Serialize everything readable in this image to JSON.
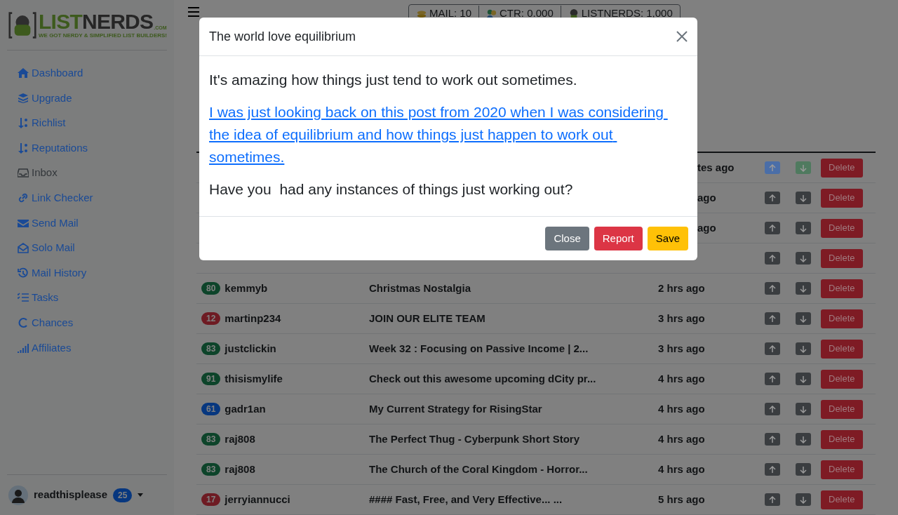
{
  "logo": {
    "word_1": "LIST",
    "word_2": "NERDS",
    "suffix": ".COM",
    "tagline": "WE GOT NERDY & SIMPLIFIED LIST BUILDERS!"
  },
  "sidebar": {
    "items": [
      {
        "label": "Dashboard",
        "selected": false
      },
      {
        "label": "Upgrade",
        "selected": false
      },
      {
        "label": "Richlist",
        "selected": false
      },
      {
        "label": "Reputations",
        "selected": false
      },
      {
        "label": "Inbox",
        "selected": true
      },
      {
        "label": "Link Checker",
        "selected": false
      },
      {
        "label": "Send Mail",
        "selected": false
      },
      {
        "label": "Solo Mail",
        "selected": false
      },
      {
        "label": "Mail History",
        "selected": false
      },
      {
        "label": "Tasks",
        "selected": false
      },
      {
        "label": "Chances",
        "selected": false
      },
      {
        "label": "Affiliates",
        "selected": false
      }
    ]
  },
  "user": {
    "name": "readthisplease",
    "count": "25"
  },
  "stats": [
    {
      "label": "MAIL: 10"
    },
    {
      "label": "CTR: 0.000"
    },
    {
      "label": "LISTNERDS: 1,000"
    }
  ],
  "rows": [
    {
      "kind": "covered",
      "time": "tes ago",
      "up_selected": true,
      "down_selected": true,
      "action": "Delete"
    },
    {
      "kind": "covered",
      "time": "ago",
      "up_selected": false,
      "down_selected": false,
      "action": "Delete"
    },
    {
      "kind": "covered",
      "time": "ago",
      "up_selected": false,
      "down_selected": false,
      "action": "Delete"
    },
    {
      "kind": "covered",
      "up_selected": false,
      "down_selected": false,
      "action": "Delete"
    },
    {
      "kind": "full",
      "score": "80",
      "color": "#0d442a",
      "user": "kemmyb",
      "title": "Christmas Nostalgia",
      "time": "2 hrs ago",
      "up_selected": false,
      "down_selected": false,
      "action": "Delete"
    },
    {
      "kind": "full",
      "score": "12",
      "color": "#6e1b23",
      "user": "martinp234",
      "title": "JOIN OUR ELITE TEAM",
      "time": "3 hrs ago",
      "up_selected": false,
      "down_selected": false,
      "action": "Delete"
    },
    {
      "kind": "full",
      "score": "83",
      "color": "#0d442a",
      "user": "justclickin",
      "title": "Week 32 : Focusing on Passive Income | 2...",
      "time": "3 hrs ago",
      "up_selected": false,
      "down_selected": false,
      "action": "Delete"
    },
    {
      "kind": "full",
      "score": "91",
      "color": "#0d442a",
      "user": "thisismylife",
      "title": "Check out this awesome upcoming dCity pr...",
      "time": "4 hrs ago",
      "up_selected": false,
      "down_selected": false,
      "action": "Delete"
    },
    {
      "kind": "full",
      "score": "61",
      "color": "#07377f",
      "user": "gadr1an",
      "title": "My Current Strategy for RisingStar",
      "time": "4 hrs ago",
      "up_selected": false,
      "down_selected": false,
      "action": "Delete"
    },
    {
      "kind": "full",
      "score": "83",
      "color": "#0d442a",
      "user": "raj808",
      "title": "The Perfect Thug - Cyberpunk Short Story",
      "time": "4 hrs ago",
      "up_selected": false,
      "down_selected": false,
      "action": "Delete"
    },
    {
      "kind": "full",
      "score": "83",
      "color": "#0d442a",
      "user": "raj808",
      "title": "The Church of the Coral Kingdom - Horror...",
      "time": "4 hrs ago",
      "up_selected": false,
      "down_selected": false,
      "action": "Delete"
    },
    {
      "kind": "full",
      "score": "17",
      "color": "#6e1b23",
      "user": "jerryiannucci",
      "title": "#### Fast, Free, and Very Effective... ...",
      "time": "5 hrs ago",
      "up_selected": false,
      "down_selected": false,
      "action": "Delete"
    }
  ],
  "modal": {
    "title": "The world love equilibrium",
    "paragraphs": [
      {
        "kind": "text",
        "text": "It's amazing how things just tend to work out sometimes."
      },
      {
        "kind": "link",
        "text": "I was just looking back on this post from 2020 when I was considering the idea of equilibrium and how things just happen to work out sometimes."
      },
      {
        "kind": "text",
        "text": "Have you  had any instances of things just working out?"
      }
    ],
    "buttons": [
      {
        "label": "Close",
        "kind": "secondary"
      },
      {
        "label": "Report",
        "kind": "danger"
      },
      {
        "label": "Save",
        "kind": "warning"
      }
    ]
  }
}
